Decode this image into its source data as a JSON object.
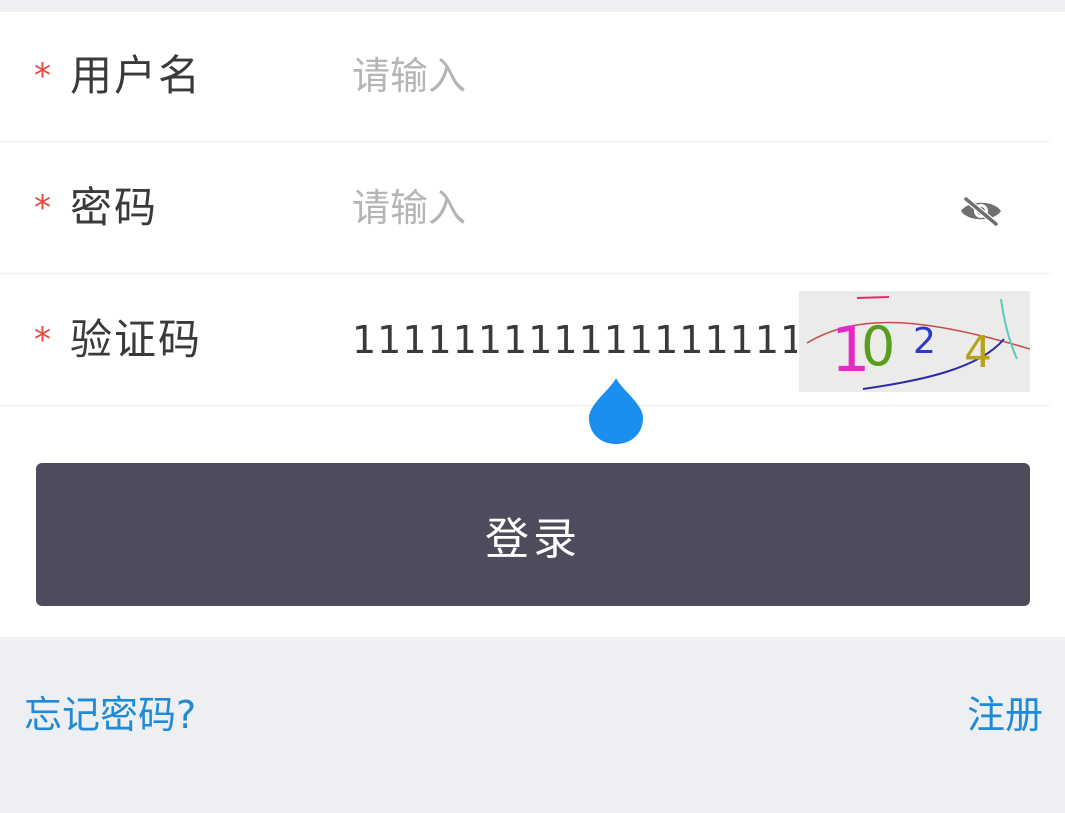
{
  "form": {
    "required_mark": "*",
    "username": {
      "label": "用户名",
      "placeholder": "请输入",
      "value": ""
    },
    "password": {
      "label": "密码",
      "placeholder": "请输入",
      "value": "",
      "visibility_icon": "eye-off-icon"
    },
    "captcha": {
      "label": "验证码",
      "value": "1111111111111111111",
      "image_text": "1024"
    }
  },
  "actions": {
    "login_label": "登录",
    "forgot_label": "忘记密码?",
    "register_label": "注册"
  },
  "colors": {
    "required": "#e5473d",
    "button_bg": "#4c4c5c",
    "link": "#1f8ad6",
    "cursor_handle": "#1a8ff0"
  }
}
